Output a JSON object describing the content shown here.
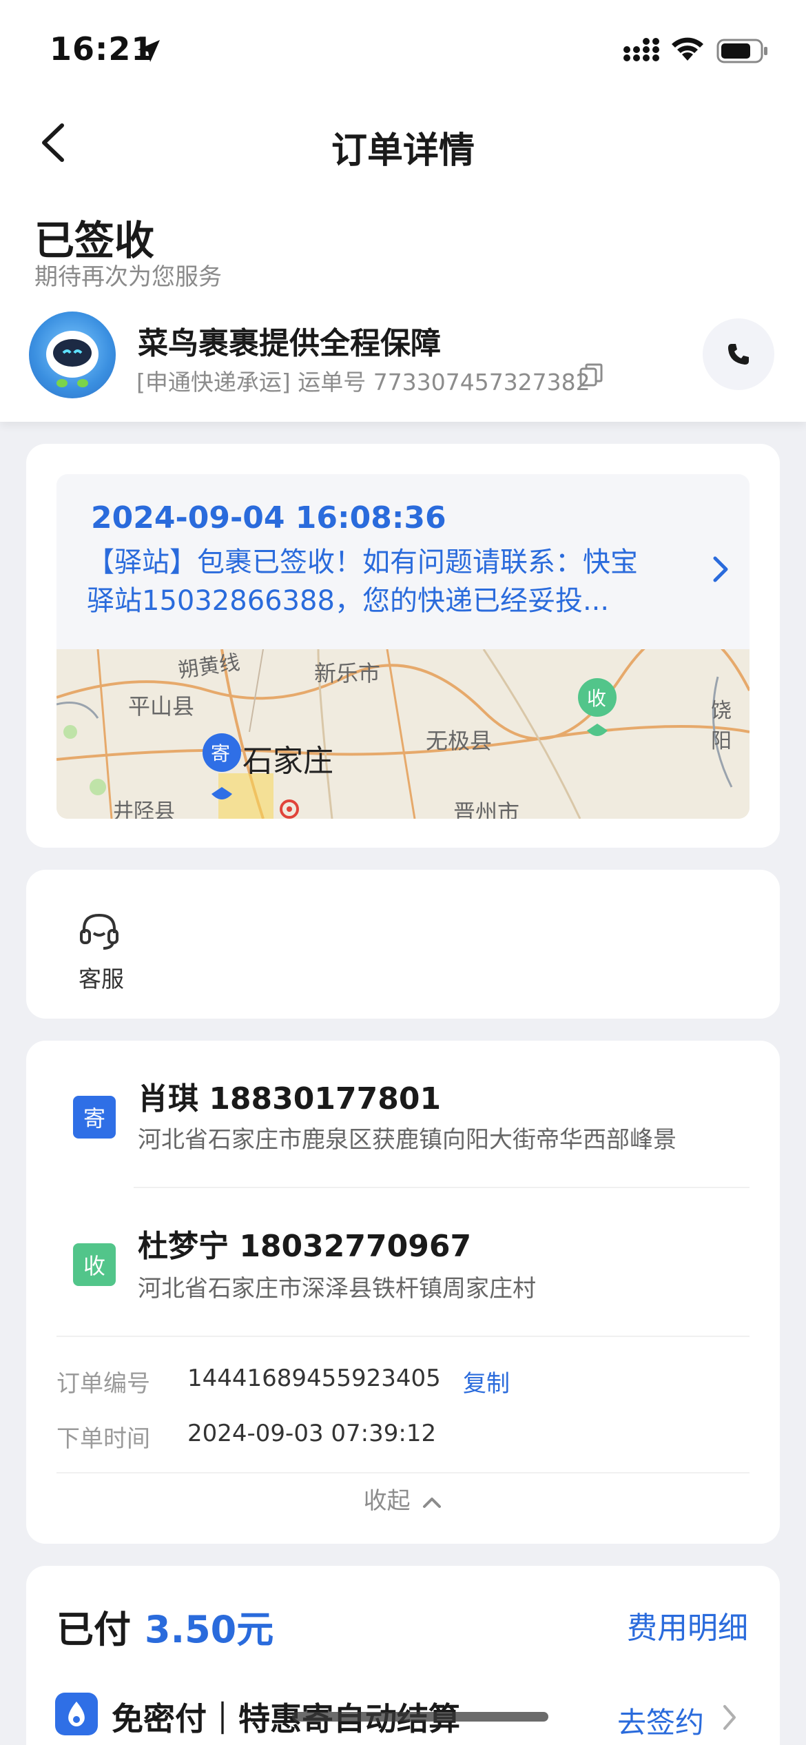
{
  "status_bar": {
    "time": "16:21"
  },
  "nav": {
    "title": "订单详情"
  },
  "status": {
    "title": "已签收",
    "subtitle": "期待再次为您服务"
  },
  "guarantee": {
    "title": "菜鸟裹裹提供全程保障",
    "carrier_line": "[申通快递承运] 运单号 773307457327382"
  },
  "tracking": {
    "time": "2024-09-04 16:08:36",
    "message": "【驿站】包裹已签收！如有问题请联系：快宝驿站15032866388，您的快递已经妥投...",
    "map": {
      "labels": [
        "朔黄线",
        "新乐市",
        "平山县",
        "无极县",
        "石家庄",
        "井陉县",
        "晋州市",
        "饶阳"
      ],
      "send_pin": "寄",
      "recv_pin": "收"
    }
  },
  "service": {
    "label": "客服"
  },
  "sender": {
    "badge": "寄",
    "name_phone": "肖琪 18830177801",
    "address": "河北省石家庄市鹿泉区获鹿镇向阳大街帝华西部峰景"
  },
  "receiver": {
    "badge": "收",
    "name_phone": "杜梦宁 18032770967",
    "address": "河北省石家庄市深泽县铁杆镇周家庄村"
  },
  "order": {
    "number_label": "订单编号",
    "number": "14441689455923405",
    "copy": "复制",
    "time_label": "下单时间",
    "time": "2024-09-03 07:39:12",
    "collapse": "收起"
  },
  "payment": {
    "paid_label": "已付",
    "amount": "3.50元",
    "fee_detail": "费用明细",
    "promo": "免密付｜特惠寄自动结算",
    "sign": "去签约"
  },
  "colors": {
    "accent": "#2a6bdc",
    "send_badge": "#2f6fe6",
    "recv_badge": "#52c58a"
  }
}
